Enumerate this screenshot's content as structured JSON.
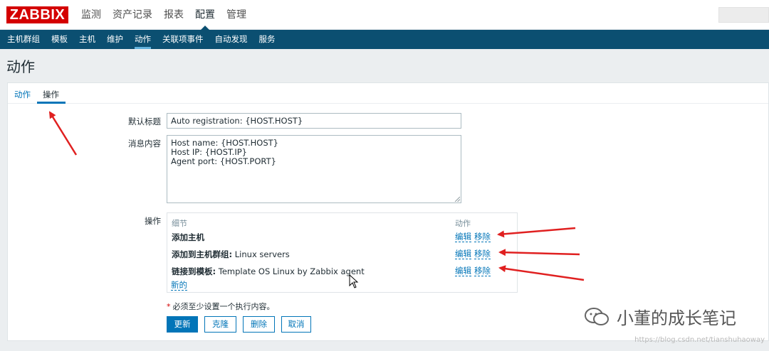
{
  "brand": {
    "logo_text": "ZABBIX",
    "logo_color": "#d40000"
  },
  "top_menu": [
    {
      "label": "监测"
    },
    {
      "label": "资产记录"
    },
    {
      "label": "报表"
    },
    {
      "label": "配置",
      "active": true
    },
    {
      "label": "管理"
    }
  ],
  "sub_menu": [
    {
      "label": "主机群组"
    },
    {
      "label": "模板"
    },
    {
      "label": "主机"
    },
    {
      "label": "维护"
    },
    {
      "label": "动作",
      "active": true
    },
    {
      "label": "关联项事件"
    },
    {
      "label": "自动发现"
    },
    {
      "label": "服务"
    }
  ],
  "page_title": "动作",
  "tabs": [
    {
      "label": "动作"
    },
    {
      "label": "操作",
      "active": true
    }
  ],
  "form": {
    "subject_label": "默认标题",
    "subject_value": "Auto registration: {HOST.HOST}",
    "message_label": "消息内容",
    "message_lines": [
      "Host name: {HOST.HOST}",
      "Host IP: {HOST.IP}",
      "Agent port: {HOST.PORT}"
    ],
    "operations_label": "操作",
    "operations_header_details": "细节",
    "operations_header_action": "动作",
    "operations": [
      {
        "bold": "添加主机",
        "rest": "",
        "edit": "编辑",
        "remove": "移除"
      },
      {
        "bold": "添加到主机群组:",
        "rest": " Linux servers",
        "edit": "编辑",
        "remove": "移除"
      },
      {
        "bold": "链接到模板:",
        "rest": " Template OS Linux by Zabbix agent",
        "edit": "编辑",
        "remove": "移除"
      }
    ],
    "new_link": "新的",
    "required_star": "*",
    "required_note": "必须至少设置一个执行内容。"
  },
  "buttons": {
    "update": "更新",
    "clone": "克隆",
    "delete": "删除",
    "cancel": "取消"
  },
  "watermark": {
    "text": "小董的成长笔记",
    "url": "https://blog.csdn.net/tianshuhaoway"
  },
  "colors": {
    "nav_dark": "#0b4f71",
    "link_blue": "#0275b8",
    "annotation_red": "#e02020"
  }
}
